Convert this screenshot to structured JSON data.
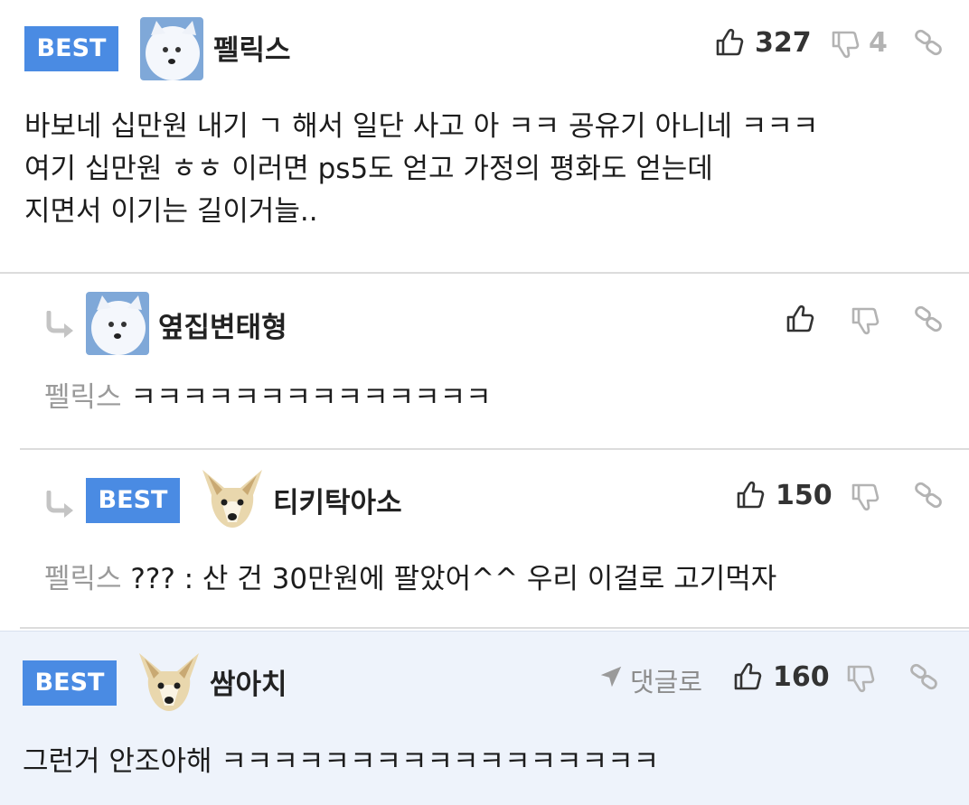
{
  "colors": {
    "best_badge": "#4a8be3",
    "highlight_bg": "#eef3fb",
    "muted": "#9a9a9a"
  },
  "comments": [
    {
      "badge": "BEST",
      "nickname": "펠릭스",
      "likes": "327",
      "dislikes": "4",
      "lines": [
        "바보네 십만원 내기 ㄱ 해서 일단 사고 아 ㅋㅋ 공유기 아니네 ㅋㅋㅋ",
        "여기 십만원 ㅎㅎ 이러면 ps5도 얻고 가정의 평화도 얻는데",
        "지면서 이기는 길이거늘.."
      ]
    },
    {
      "nickname": "옆집변태형",
      "mention": "펠릭스",
      "text": "ㅋㅋㅋㅋㅋㅋㅋㅋㅋㅋㅋㅋㅋㅋ"
    },
    {
      "badge": "BEST",
      "nickname": "티키탁아소",
      "likes": "150",
      "mention": "펠릭스",
      "text": "??? : 산 건 30만원에 팔았어^^ 우리 이걸로 고기먹자"
    },
    {
      "badge": "BEST",
      "nickname": "쌈아치",
      "reply_link": "댓글로",
      "likes": "160",
      "text": "그런거 안조아해 ㅋㅋㅋㅋㅋㅋㅋㅋㅋㅋㅋㅋㅋㅋㅋㅋㅋ"
    }
  ],
  "icons": [
    "thumbs-up-icon",
    "thumbs-down-icon",
    "link-icon",
    "reply-arrow-icon",
    "send-arrow-icon"
  ]
}
